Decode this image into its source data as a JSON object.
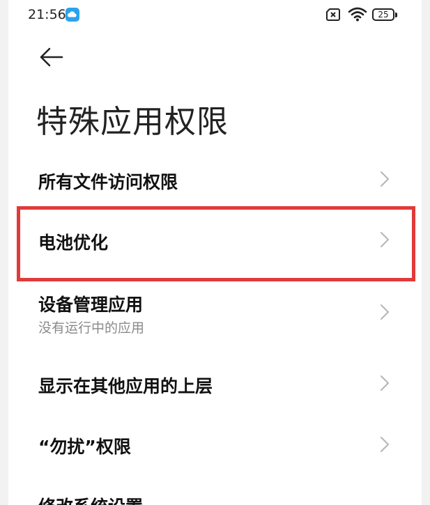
{
  "status": {
    "time": "21:56",
    "battery": "25"
  },
  "page": {
    "title": "特殊应用权限"
  },
  "items": [
    {
      "label": "所有文件访问权限",
      "sub": ""
    },
    {
      "label": "电池优化",
      "sub": ""
    },
    {
      "label": "设备管理应用",
      "sub": "没有运行中的应用"
    },
    {
      "label": "显示在其他应用的上层",
      "sub": ""
    },
    {
      "label": "“勿扰”权限",
      "sub": ""
    },
    {
      "label": "修改系统设置",
      "sub": ""
    }
  ],
  "icons": {
    "back": "back-arrow-icon",
    "chevron": "chevron-right-icon",
    "cloud": "cloud-icon",
    "sim": "no-sim-icon",
    "wifi": "wifi-icon",
    "battery": "battery-icon"
  },
  "colors": {
    "highlight": "#e03a3a",
    "cloud": "#2aa3ef",
    "chevron": "#b5b5b5"
  }
}
